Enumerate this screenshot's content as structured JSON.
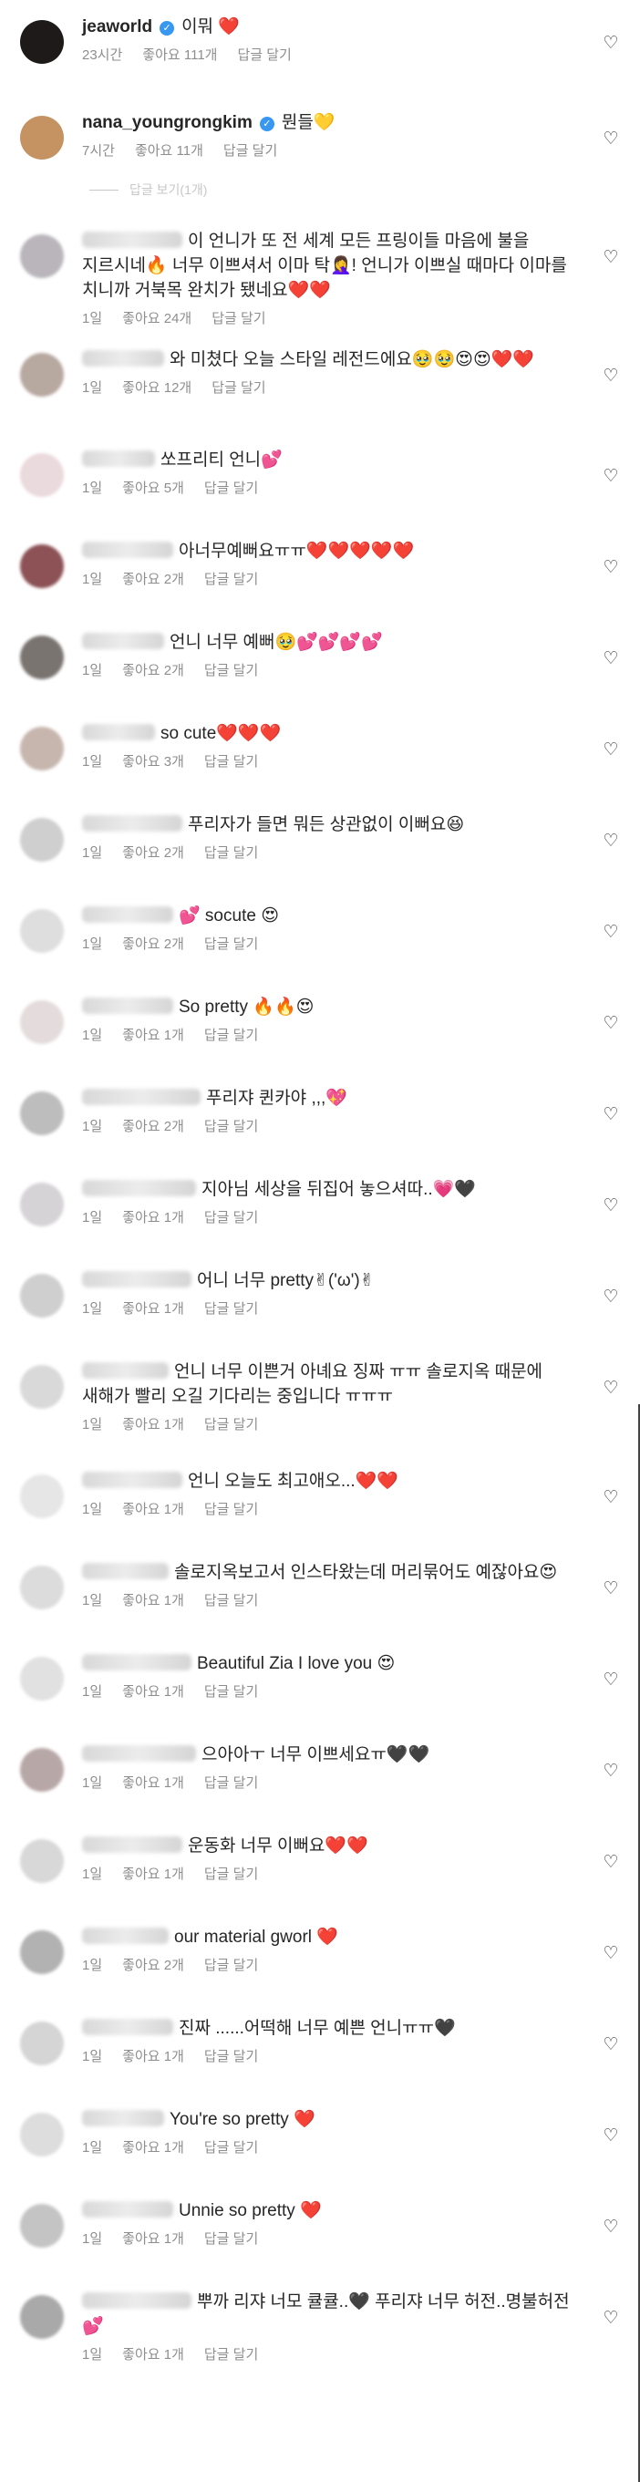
{
  "comments": [
    {
      "username": "jeaworld",
      "verified": true,
      "text": "이뭐 ❤️",
      "time": "23시간",
      "likes": "좋아요 111개",
      "reply_label": "답글 달기",
      "avatar": "#1d1a19"
    },
    {
      "username": "nana_youngrongkim",
      "verified": true,
      "text": "뭔들💛",
      "time": "7시간",
      "likes": "좋아요 11개",
      "reply_label": "답글 달기",
      "avatar": "#c59262"
    },
    {
      "username": "",
      "verified": false,
      "text": "이 언니가 또 전 세계 모든 프링이들 마음에 불을 지르시네🔥 너무 이쁘셔서 이마 탁🤦‍♀️! 언니가 이쁘실 때마다 이마를 치니까 거북목 완치가 됐네요❤️❤️",
      "time": "1일",
      "likes": "좋아요 24개",
      "reply_label": "답글 달기",
      "avatar": "#b9b5bb"
    },
    {
      "username": "",
      "verified": false,
      "text": "와 미쳤다 오늘 스타일 레전드에요🥹🥹😍😍❤️❤️",
      "time": "1일",
      "likes": "좋아요 12개",
      "reply_label": "답글 달기",
      "avatar": "#b7a8a0"
    },
    {
      "username": "",
      "verified": false,
      "text": "쏘프리티 언니💕",
      "time": "1일",
      "likes": "좋아요 5개",
      "reply_label": "답글 달기",
      "avatar": "#ead9dd"
    },
    {
      "username": "",
      "verified": false,
      "text": "아너무예뻐요ㅠㅠ❤️❤️❤️❤️❤️",
      "time": "1일",
      "likes": "좋아요 2개",
      "reply_label": "답글 달기",
      "avatar": "#8c5255"
    },
    {
      "username": "",
      "verified": false,
      "text": "언니 너무 예뻐🥹💕💕💕💕",
      "time": "1일",
      "likes": "좋아요 2개",
      "reply_label": "답글 달기",
      "avatar": "#7a7470"
    },
    {
      "username": "",
      "verified": false,
      "text": "so cute❤️❤️❤️",
      "time": "1일",
      "likes": "좋아요 3개",
      "reply_label": "답글 달기",
      "avatar": "#c7b6ae"
    },
    {
      "username": "",
      "verified": false,
      "text": "푸리자가 들면 뭐든 상관없이 이뻐요😆",
      "time": "1일",
      "likes": "좋아요 2개",
      "reply_label": "답글 달기",
      "avatar": "#cfcfcf"
    },
    {
      "username": "",
      "verified": false,
      "text": "💕 socute 😍",
      "time": "1일",
      "likes": "좋아요 2개",
      "reply_label": "답글 달기",
      "avatar": "#dedede"
    },
    {
      "username": "",
      "verified": false,
      "text": "So pretty 🔥🔥😍",
      "time": "1일",
      "likes": "좋아요 1개",
      "reply_label": "답글 달기",
      "avatar": "#e4dcdc"
    },
    {
      "username": "",
      "verified": false,
      "text": "푸리쟈 퀸카야 ,,,💖",
      "time": "1일",
      "likes": "좋아요 2개",
      "reply_label": "답글 달기",
      "avatar": "#bdbdbd"
    },
    {
      "username": "",
      "verified": false,
      "text": "지아님 세상을 뒤집어 놓으셔따..💗🖤",
      "time": "1일",
      "likes": "좋아요 1개",
      "reply_label": "답글 달기",
      "avatar": "#d6d3d6"
    },
    {
      "username": "",
      "verified": false,
      "text": "어니 너무 pretty✌︎('ω')✌︎",
      "time": "1일",
      "likes": "좋아요 1개",
      "reply_label": "답글 달기",
      "avatar": "#cfcfcf"
    },
    {
      "username": "",
      "verified": false,
      "text": "언니 너무 이쁜거 아녜요 징짜 ㅠㅠ 솔로지옥 때문에 새해가 빨리 오길 기다리는 중입니다 ㅠㅠㅠ",
      "time": "1일",
      "likes": "좋아요 1개",
      "reply_label": "답글 달기",
      "avatar": "#d9d9d9"
    },
    {
      "username": "",
      "verified": false,
      "text": "언니 오늘도 최고애오...❤️❤️",
      "time": "1일",
      "likes": "좋아요 1개",
      "reply_label": "답글 달기",
      "avatar": "#e6e6e6"
    },
    {
      "username": "",
      "verified": false,
      "text": "솔로지옥보고서 인스타왔는데 머리묶어도 예잖아요😍",
      "time": "1일",
      "likes": "좋아요 1개",
      "reply_label": "답글 달기",
      "avatar": "#dcdcdc"
    },
    {
      "username": "",
      "verified": false,
      "text": "Beautiful Zia I love you 😍",
      "time": "1일",
      "likes": "좋아요 1개",
      "reply_label": "답글 달기",
      "avatar": "#e1e1e1"
    },
    {
      "username": "",
      "verified": false,
      "text": "으아아ㅜ 너무 이쁘세요ㅠ🖤🖤",
      "time": "1일",
      "likes": "좋아요 1개",
      "reply_label": "답글 달기",
      "avatar": "#b8a7a7"
    },
    {
      "username": "",
      "verified": false,
      "text": "운동화 너무 이뻐요❤️❤️",
      "time": "1일",
      "likes": "좋아요 1개",
      "reply_label": "답글 달기",
      "avatar": "#d8d8d8"
    },
    {
      "username": "",
      "verified": false,
      "text": "our material gworl ❤️",
      "time": "1일",
      "likes": "좋아요 2개",
      "reply_label": "답글 달기",
      "avatar": "#b2b2b2"
    },
    {
      "username": "",
      "verified": false,
      "text": "진짜 ......어떡해 너무 예쁜 언니ㅠㅠ🖤",
      "time": "1일",
      "likes": "좋아요 1개",
      "reply_label": "답글 달기",
      "avatar": "#d5d5d5"
    },
    {
      "username": "",
      "verified": false,
      "text": "You're so pretty ❤️",
      "time": "1일",
      "likes": "좋아요 1개",
      "reply_label": "답글 달기",
      "avatar": "#dddddd"
    },
    {
      "username": "",
      "verified": false,
      "text": "Unnie so pretty ❤️",
      "time": "1일",
      "likes": "좋아요 1개",
      "reply_label": "답글 달기",
      "avatar": "#c4c4c4"
    },
    {
      "username": "",
      "verified": false,
      "text": "뿌까 리쟈 너모 큘큘..🖤 푸리쟈 너무 허전..명불허전 💕",
      "time": "1일",
      "likes": "좋아요 1개",
      "reply_label": "답글 달기",
      "avatar": "#a9a9a9"
    }
  ],
  "hidden_replies_label": "답글 보기(1개)",
  "icons": {
    "like": "heart-outline-icon",
    "verified": "verified-badge-icon"
  }
}
